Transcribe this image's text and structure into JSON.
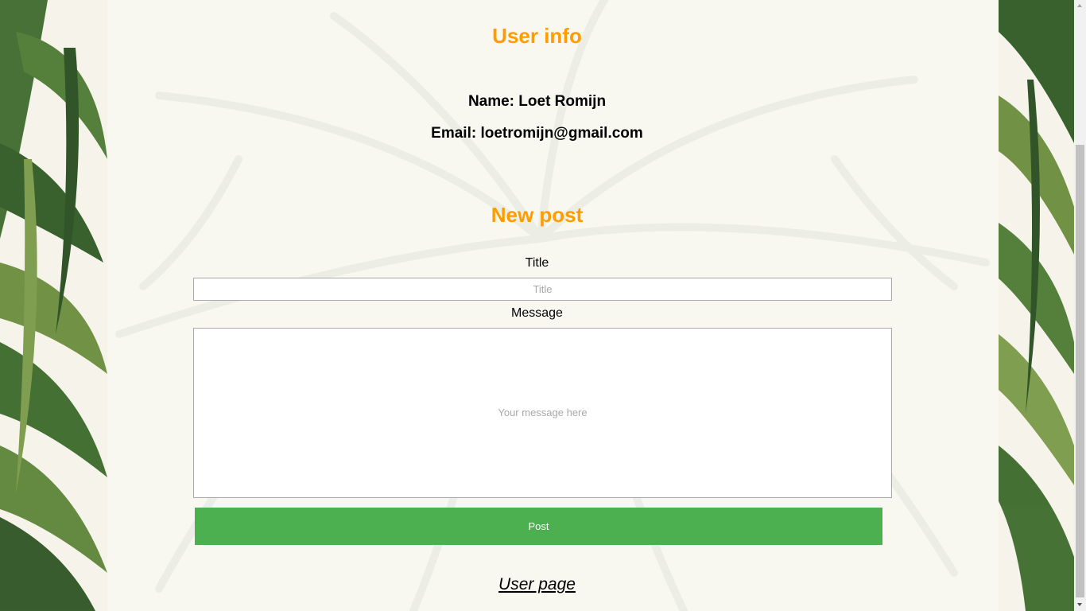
{
  "user_info": {
    "heading": "User info",
    "name_line": "Name: Loet Romijn",
    "email_line": "Email: loetromijn@gmail.com"
  },
  "new_post": {
    "heading": "New post",
    "title_label": "Title",
    "title_placeholder": "Title",
    "title_value": "",
    "message_label": "Message",
    "message_placeholder": "Your message here",
    "message_value": "",
    "post_button": "Post"
  },
  "footer": {
    "user_page_link": "User page"
  },
  "colors": {
    "heading": "#ff9d00",
    "button": "#4caf50",
    "button_text": "#ffffff"
  },
  "scrollbar": {
    "visible": true
  }
}
